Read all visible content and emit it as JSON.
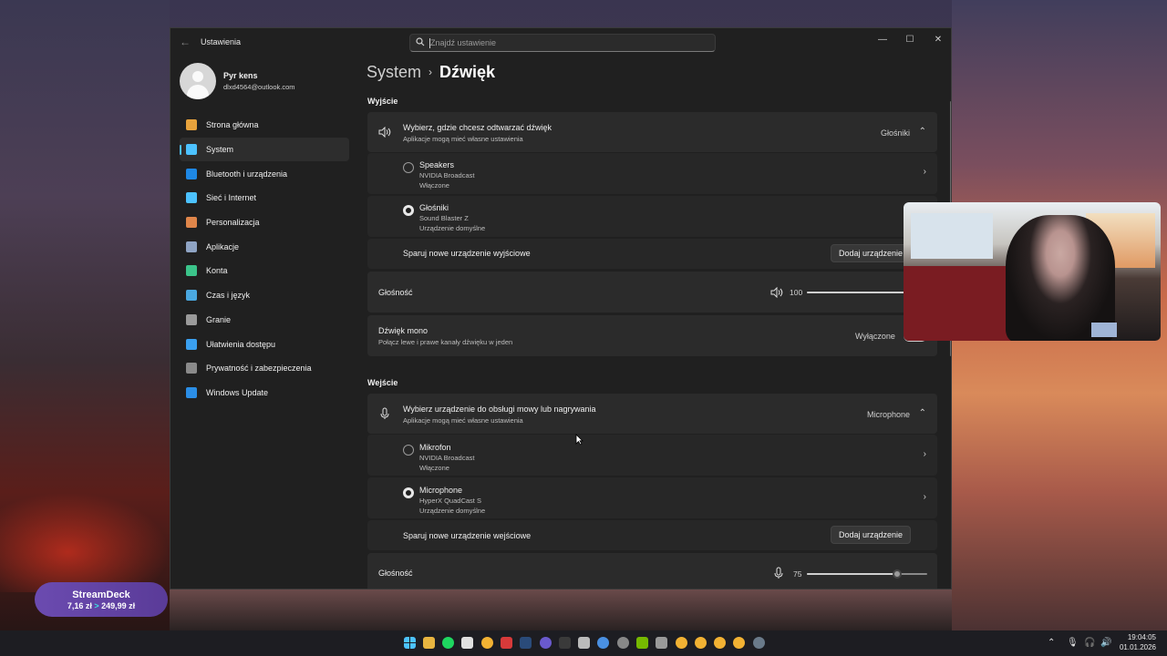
{
  "window": {
    "app_title": "Ustawienia",
    "search_placeholder": "Znajdź ustawienie",
    "controls": {
      "minimize": "—",
      "maximize": "☐",
      "close": "✕"
    }
  },
  "user": {
    "name": "Pyr kens",
    "email": "dlxd4564@outlook.com"
  },
  "sidebar": {
    "items": [
      {
        "label": "Strona główna",
        "icon": "home-icon",
        "color": "#e8a33c"
      },
      {
        "label": "System",
        "icon": "system-icon",
        "color": "#4cc2ff",
        "active": true
      },
      {
        "label": "Bluetooth i urządzenia",
        "icon": "bluetooth-icon",
        "color": "#1e88e5"
      },
      {
        "label": "Sieć i Internet",
        "icon": "wifi-icon",
        "color": "#4cc2ff"
      },
      {
        "label": "Personalizacja",
        "icon": "brush-icon",
        "color": "#e0864a"
      },
      {
        "label": "Aplikacje",
        "icon": "apps-icon",
        "color": "#8fa4c4"
      },
      {
        "label": "Konta",
        "icon": "account-icon",
        "color": "#3bc48a"
      },
      {
        "label": "Czas i język",
        "icon": "globe-clock-icon",
        "color": "#4aa8e0"
      },
      {
        "label": "Granie",
        "icon": "gamepad-icon",
        "color": "#9a9a9a"
      },
      {
        "label": "Ułatwienia dostępu",
        "icon": "accessibility-icon",
        "color": "#3aa0f0"
      },
      {
        "label": "Prywatność i zabezpieczenia",
        "icon": "shield-icon",
        "color": "#8a8a8a"
      },
      {
        "label": "Windows Update",
        "icon": "update-icon",
        "color": "#2b8ee6"
      }
    ]
  },
  "breadcrumb": {
    "parent": "System",
    "separator": "›",
    "current": "Dźwięk"
  },
  "output": {
    "section_title": "Wyjście",
    "choose_title": "Wybierz, gdzie chcesz odtwarzać dźwięk",
    "choose_subtitle": "Aplikacje mogą mieć własne ustawienia",
    "selected": "Głośniki",
    "devices": [
      {
        "name": "Speakers",
        "driver": "NVIDIA Broadcast",
        "status": "Włączone",
        "selected": false
      },
      {
        "name": "Głośniki",
        "driver": "Sound Blaster Z",
        "status": "Urządzenie domyślne",
        "selected": true
      }
    ],
    "pair_label": "Sparuj nowe urządzenie wyjściowe",
    "add_button": "Dodaj urządzenie",
    "volume_label": "Głośność",
    "volume_value": "100",
    "volume_fraction": 1.0,
    "mono_title": "Dźwięk mono",
    "mono_subtitle": "Połącz lewe i prawe kanały dźwięku w jeden",
    "mono_state": "Wyłączone"
  },
  "input": {
    "section_title": "Wejście",
    "choose_title": "Wybierz urządzenie do obsługi mowy lub nagrywania",
    "choose_subtitle": "Aplikacje mogą mieć własne ustawienia",
    "selected": "Microphone",
    "devices": [
      {
        "name": "Mikrofon",
        "driver": "NVIDIA Broadcast",
        "status": "Włączone",
        "selected": false
      },
      {
        "name": "Microphone",
        "driver": "HyperX QuadCast S",
        "status": "Urządzenie domyślne",
        "selected": true
      }
    ],
    "pair_label": "Sparuj nowe urządzenie wejściowe",
    "add_button": "Dodaj urządzenie",
    "volume_label": "Głośność",
    "volume_value": "75",
    "volume_fraction": 0.75
  },
  "streamdeck": {
    "title": "StreamDeck",
    "price_old": "7,16 zł",
    "arrow": ">",
    "price_new": "249,99 zł"
  },
  "taskbar": {
    "time": "19:04:05",
    "date": "01.01.2026",
    "tray_icons": [
      "chevron-up-icon",
      "microphone-icon",
      "headset-icon",
      "speaker-icon"
    ]
  }
}
